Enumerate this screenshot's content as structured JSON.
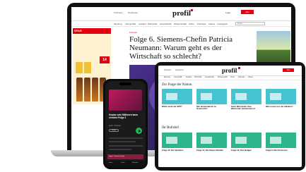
{
  "laptop": {
    "top_links": [
      "Podcasts",
      "Newsletter",
      "Login"
    ],
    "logo": "profil",
    "login": "Login",
    "abo_button": "Abo",
    "nav": [
      "Meinung",
      "Innenpolitik",
      "Ausland",
      "Wirtschaft",
      "Gesellschaft",
      "Wissenschaft",
      "Kultur",
      "Podcasts",
      "Videos",
      "Investigativ"
    ],
    "search_placeholder": "Suche",
    "ad_header": "SPAR",
    "ad_price": "14",
    "article": {
      "category": "Podcast",
      "headline": "Folge 6. Siemens-Chefin Patricia Neumann: Warum geht es der Wirtschaft so schlecht?"
    }
  },
  "tablet": {
    "top_links": [
      "Podcasts",
      "Newsletter"
    ],
    "logo": "profil",
    "abo_button": "Abo",
    "nav": [
      "Meinung",
      "Innenpolitik",
      "Ausland",
      "Wirtschaft",
      "Gesellschaft",
      "Wissenschaft",
      "Kultur",
      "Podcasts",
      "Videos"
    ],
    "sections": [
      {
        "title": "Zur Frage der Nation.",
        "cards": [
          "Wofür steht die SPÖ?",
          "Wie demokratisch ist Österreich?",
          "Kann Wirtschaft ohne Wachstum funktionieren?",
          "Was kostet uns die Inflation?"
        ]
      },
      {
        "title": "Ihr Bullshit!",
        "cards": [
          "Folge 12: Der Sparkurs",
          "Folge 11: Die Steuer-Debatte",
          "Folge 10: Das Budget",
          "Folge 9: Die Pensionen"
        ]
      }
    ]
  },
  "phone": {
    "title": "Gustav sein Millionen kann ehrliche Folge 2",
    "meta": "profil · Podcast",
    "follow": "Folgen",
    "now_playing": "Folge 6. Siemens-Chefin",
    "tabs": [
      "Home",
      "Suche",
      "Bibliothek"
    ]
  }
}
